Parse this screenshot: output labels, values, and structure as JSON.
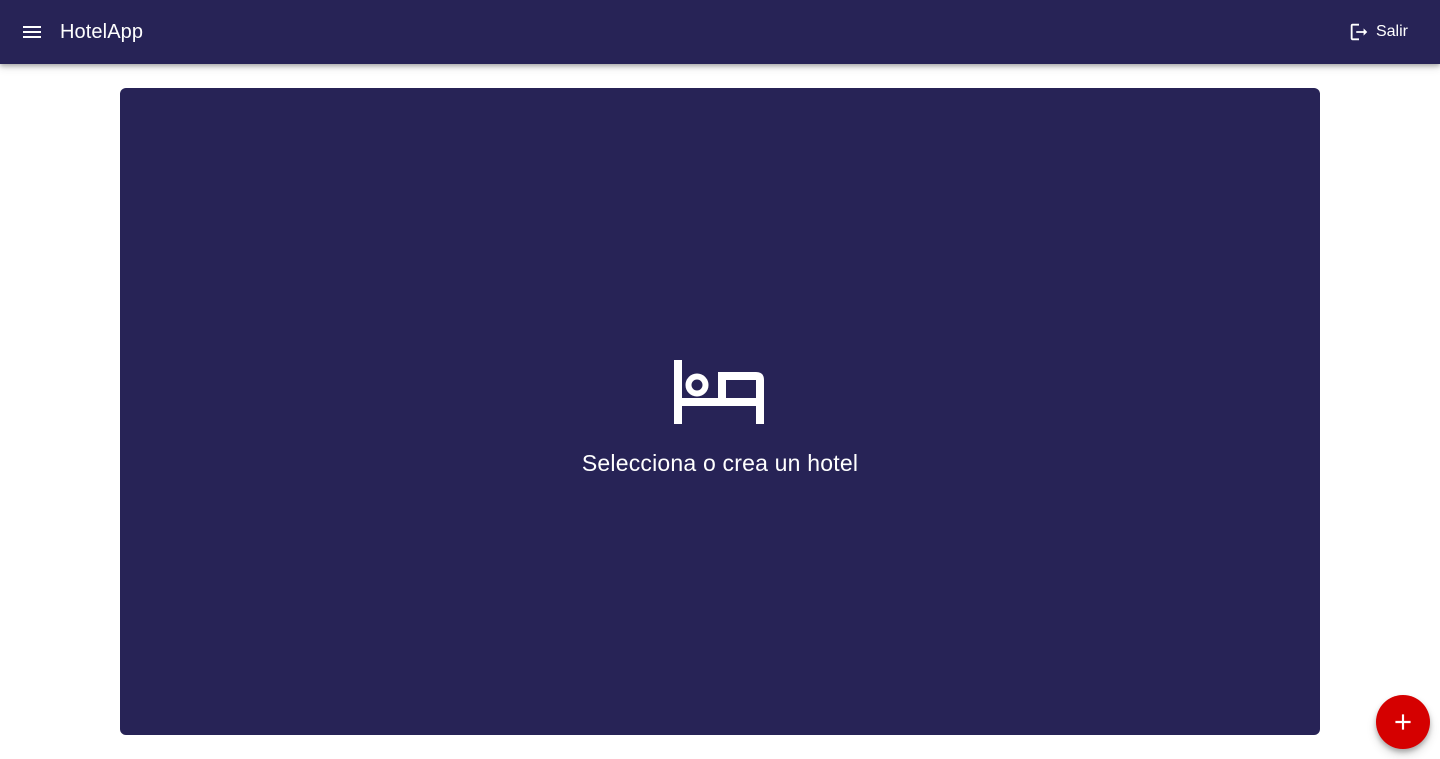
{
  "header": {
    "menu_icon": "menu-icon",
    "title": "HotelApp",
    "logout_icon": "logout-icon",
    "logout_label": "Salir"
  },
  "main": {
    "empty_icon": "hotel-bed-icon",
    "empty_message": "Selecciona o crea un hotel"
  },
  "fab": {
    "icon": "plus-icon"
  },
  "colors": {
    "primary": "#272356",
    "accent": "#d50000",
    "on_primary": "#ffffff",
    "background": "#ffffff"
  }
}
